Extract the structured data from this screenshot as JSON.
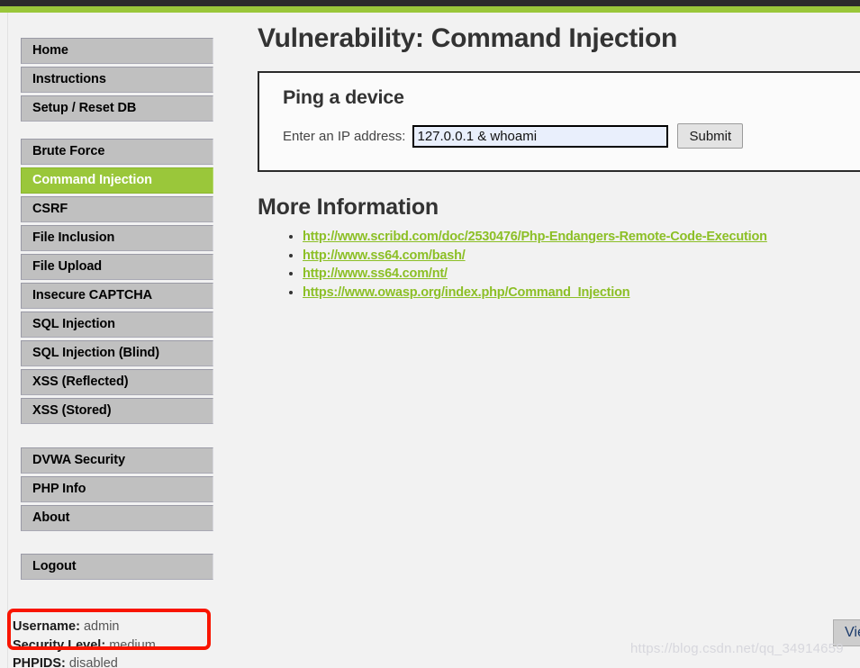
{
  "header": {
    "dark_bar_color": "#2b2b2b",
    "accent_color": "#9ac73a"
  },
  "sidebar": {
    "groups": [
      {
        "items": [
          {
            "label": "Home",
            "active": false
          },
          {
            "label": "Instructions",
            "active": false
          },
          {
            "label": "Setup / Reset DB",
            "active": false
          }
        ]
      },
      {
        "items": [
          {
            "label": "Brute Force",
            "active": false
          },
          {
            "label": "Command Injection",
            "active": true
          },
          {
            "label": "CSRF",
            "active": false
          },
          {
            "label": "File Inclusion",
            "active": false
          },
          {
            "label": "File Upload",
            "active": false
          },
          {
            "label": "Insecure CAPTCHA",
            "active": false
          },
          {
            "label": "SQL Injection",
            "active": false
          },
          {
            "label": "SQL Injection (Blind)",
            "active": false
          },
          {
            "label": "XSS (Reflected)",
            "active": false
          },
          {
            "label": "XSS (Stored)",
            "active": false
          }
        ]
      },
      {
        "items": [
          {
            "label": "DVWA Security",
            "active": false
          },
          {
            "label": "PHP Info",
            "active": false
          },
          {
            "label": "About",
            "active": false
          }
        ]
      },
      {
        "items": [
          {
            "label": "Logout",
            "active": false
          }
        ]
      }
    ]
  },
  "status": {
    "username_key": "Username:",
    "username_value": "admin",
    "security_key": "Security Level:",
    "security_value": "medium",
    "phpids_key": "PHPIDS:",
    "phpids_value": "disabled",
    "highlight_color": "#f91500"
  },
  "main": {
    "page_title": "Vulnerability: Command Injection",
    "panel": {
      "heading": "Ping a device",
      "field_label": "Enter an IP address:",
      "input_value": "127.0.0.1 & whoami",
      "input_placeholder": "",
      "submit_label": "Submit"
    },
    "more_information": {
      "heading": "More Information",
      "links": [
        "http://www.scribd.com/doc/2530476/Php-Endangers-Remote-Code-Execution",
        "http://www.ss64.com/bash/",
        "http://www.ss64.com/nt/",
        "https://www.owasp.org/index.php/Command_Injection"
      ]
    }
  },
  "footer": {
    "view_source_label": "View Source",
    "watermark": "https://blog.csdn.net/qq_34914659"
  }
}
